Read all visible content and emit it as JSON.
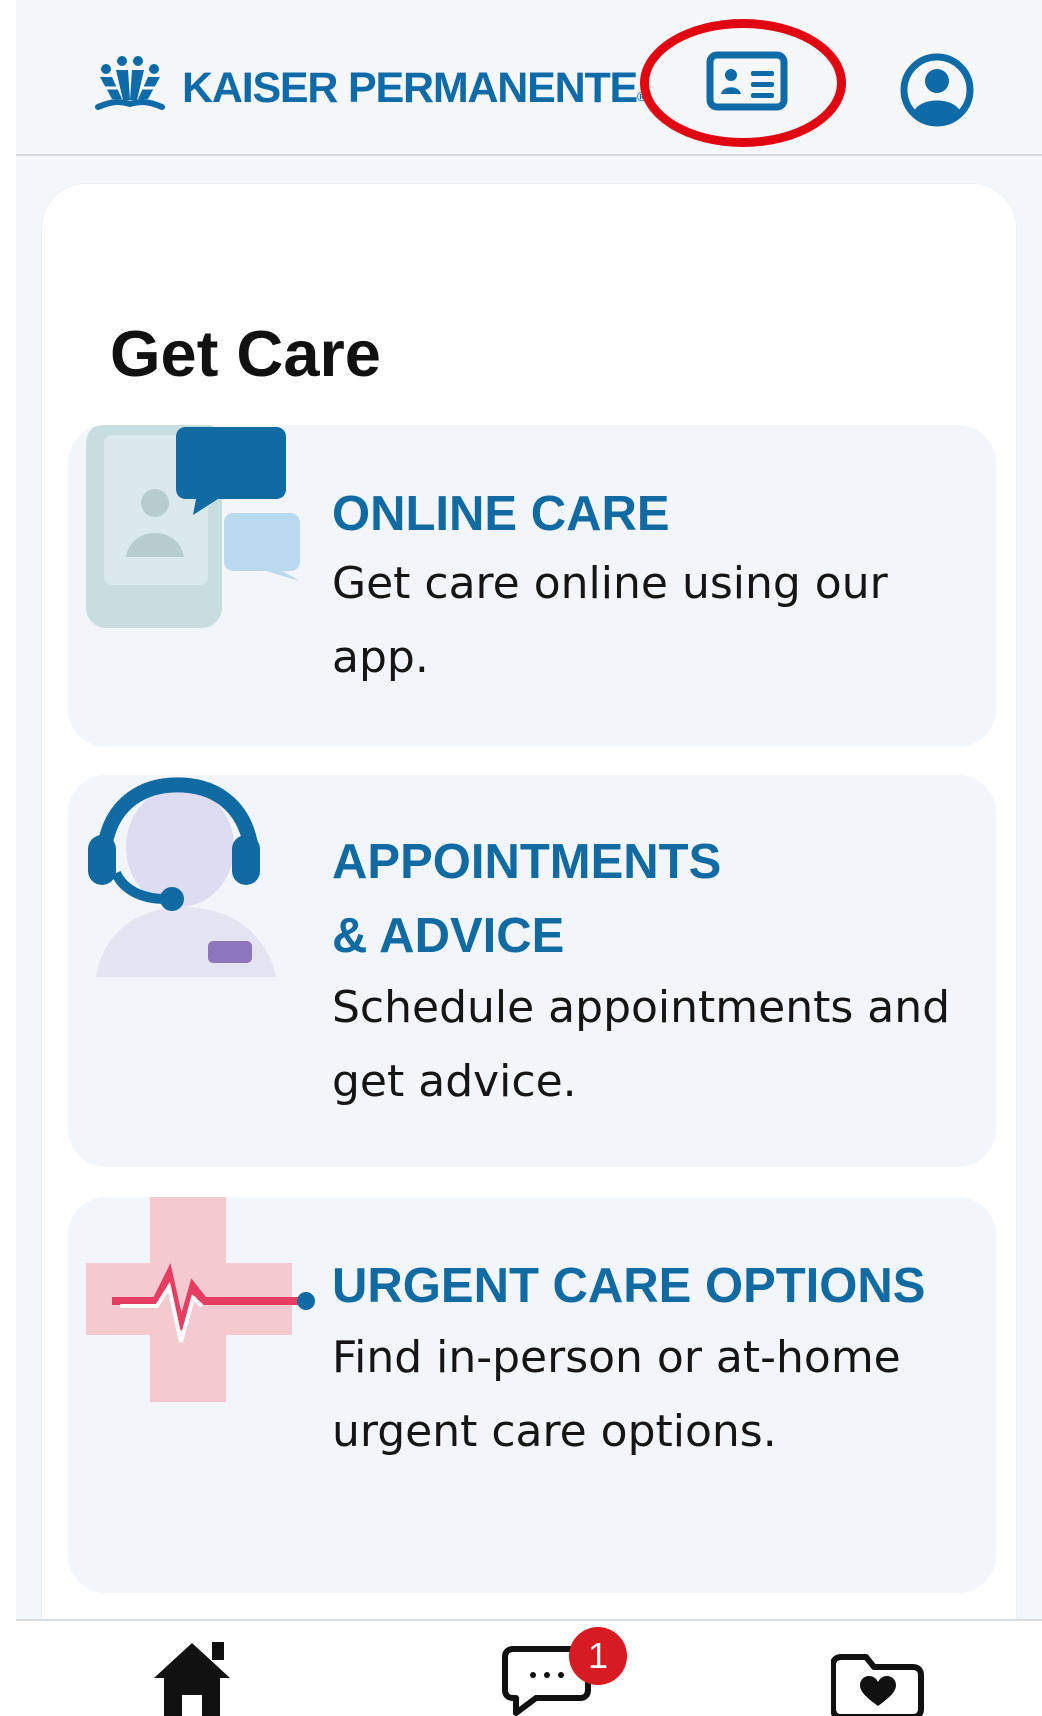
{
  "header": {
    "brand": "KAISER PERMANENTE",
    "registered_mark": "®"
  },
  "main": {
    "title": "Get Care",
    "cards": [
      {
        "title": "ONLINE CARE",
        "description": "Get care online using our app."
      },
      {
        "title_line_1": "APPOINTMENTS",
        "title_line_2": "& ADVICE",
        "description": "Schedule appointments and get advice."
      },
      {
        "title": "URGENT CARE OPTIONS",
        "description": "Find in-person or at-home urgent care options."
      }
    ]
  },
  "bottom_nav": {
    "message_count": "1"
  },
  "icons": {
    "id_card": "id-card-icon",
    "profile": "profile-icon",
    "home": "home-icon",
    "messages": "message-icon",
    "records": "folder-heart-icon"
  },
  "colors": {
    "brand_blue": "#0f6aa8",
    "card_background": "#f2f6fa",
    "badge_red": "#d71b22",
    "highlight_red": "#e00712"
  }
}
